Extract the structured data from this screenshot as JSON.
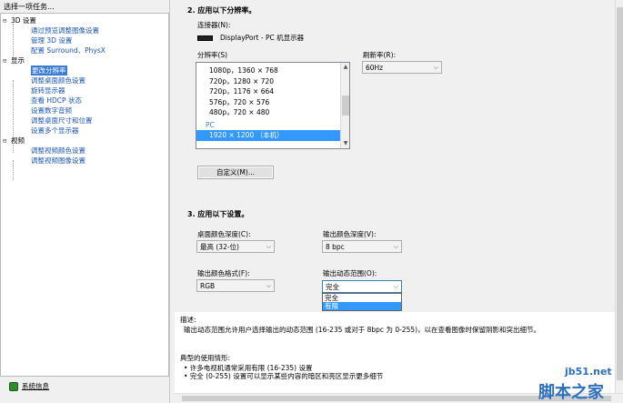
{
  "left": {
    "title": "选择一项任务...",
    "tree": [
      {
        "label": "3D 设置",
        "children": [
          "通过预览调整图像设置",
          "管理 3D 设置",
          "配置 Surround、PhysX"
        ]
      },
      {
        "label": "显示",
        "children": [
          "更改分辨率",
          "调整桌面颜色设置",
          "旋转显示器",
          "查看 HDCP 状态",
          "设置数字音频",
          "调整桌面尺寸和位置",
          "设置多个显示器"
        ]
      },
      {
        "label": "视频",
        "children": [
          "调整视频颜色设置",
          "调整视频图像设置"
        ]
      }
    ],
    "selected": "更改分辨率",
    "system_info": "系统信息"
  },
  "main": {
    "section2_title": "2. 应用以下分辨率。",
    "connector_label": "连接器(N):",
    "connector_value": "DisplayPort - PC 机显示器",
    "resolution_label": "分辨率(S)",
    "resolutions": [
      "1080p，1360 × 768",
      "720p，1280 × 720",
      "720p，1176 × 664",
      "576p，720 × 576",
      "480p，720 × 480"
    ],
    "resolution_group": "PC",
    "resolution_selected": "1920 × 1200 （本机）",
    "refresh_label": "刷新率(R):",
    "refresh_value": "60Hz",
    "custom_button": "自定义(M)...",
    "section3_title": "3. 应用以下设置。",
    "desktop_depth_label": "桌面颜色深度(C):",
    "desktop_depth_value": "最高 (32-位)",
    "output_depth_label": "输出颜色深度(V):",
    "output_depth_value": "8 bpc",
    "output_format_label": "输出颜色格式(F):",
    "output_format_value": "RGB",
    "dynamic_range_label": "输出动态范围(O):",
    "dynamic_range_value": "完全",
    "dynamic_range_options": [
      "完全",
      "有限"
    ]
  },
  "description": {
    "title": "描述:",
    "text": "输出动态范围允许用户选择输出的动态范围 (16-235 或对于 8bpc 为 0-255)，以在查看图像时保留阴影和突出细节。",
    "usage_title": "典型的使用情形:",
    "usage_items": [
      "• 许多电视机通常采用有限 (16-235) 设置",
      "• 完全 (0-255) 设置可以显示某些内容的暗区和亮区显示更多细节"
    ]
  },
  "watermark": {
    "site": "jb51.net",
    "name": "脚本之家"
  }
}
